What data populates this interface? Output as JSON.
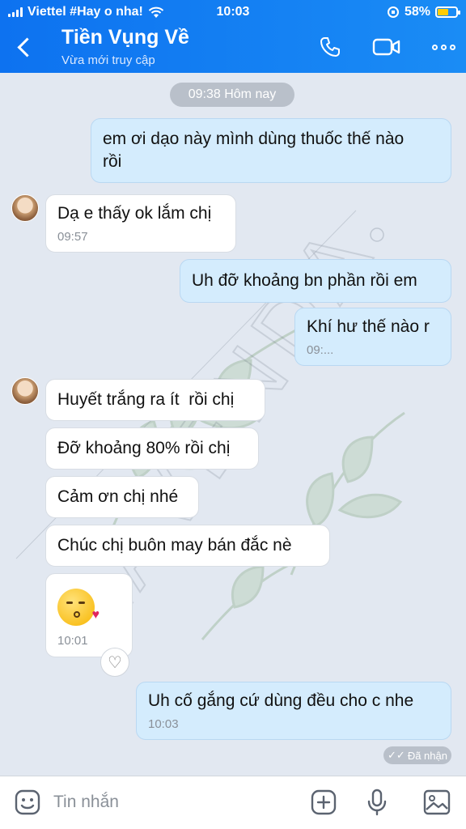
{
  "status_bar": {
    "carrier": "Viettel #Hay o nha!",
    "time": "10:03",
    "battery": "58%"
  },
  "header": {
    "contact_name": "Tiền Vụng Về",
    "contact_status": "Vừa mới truy cập"
  },
  "watermark": {
    "text": "LAVENDA"
  },
  "chat": {
    "time_separator": "09:38 Hôm nay",
    "messages": [
      {
        "side": "out",
        "lines": [
          "em ơi dạo này mình dùng thuốc thế nào",
          "rồi"
        ]
      },
      {
        "side": "in",
        "text": "Dạ e thấy ok lắm chị",
        "time": "09:57"
      },
      {
        "side": "out",
        "text": "Uh đỡ khoảng bn phần rồi em"
      },
      {
        "side": "out",
        "text": "Khí hư thế nào r",
        "time": "09:..."
      },
      {
        "side": "in",
        "text": "Huyết trắng ra ít  rồi chị"
      },
      {
        "side": "in",
        "text": "Đỡ khoảng 80% rồi chị"
      },
      {
        "side": "in",
        "text": "Cảm ơn chị nhé"
      },
      {
        "side": "in",
        "text": "Chúc chị buôn may bán đắc nè"
      },
      {
        "side": "in",
        "emoji": "kissing-face",
        "time": "10:01"
      },
      {
        "side": "out",
        "text": "Uh cố gắng cứ dùng đều cho c nhe",
        "time": "10:03"
      }
    ],
    "received_label": "Đã nhận"
  },
  "composer": {
    "placeholder": "Tin nhắn"
  },
  "colors": {
    "header": "#0d72f0",
    "background": "#e2e8f1",
    "out_bubble": "#d4ecfd",
    "in_bubble": "#ffffff"
  },
  "icons": [
    "back-icon",
    "phone-icon",
    "video-call-icon",
    "more-icon",
    "sticker-icon",
    "add-icon",
    "microphone-icon",
    "image-icon",
    "heart-react-icon"
  ]
}
